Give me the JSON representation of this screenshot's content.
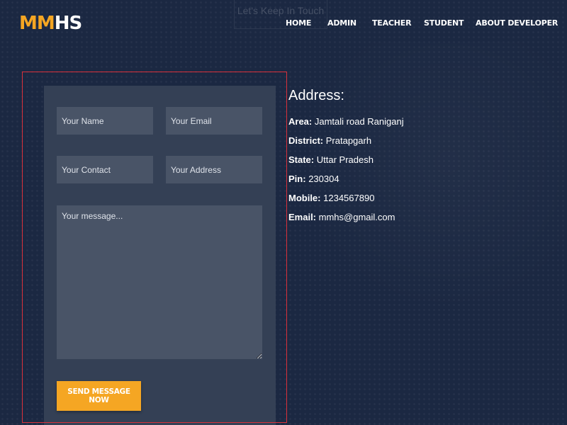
{
  "brand": {
    "logo_part1": "MM",
    "logo_part2": "HS"
  },
  "tagline": "Let's Keep In Touch",
  "nav": {
    "items": [
      {
        "label": "HOME"
      },
      {
        "label": "ADMIN"
      },
      {
        "label": "TEACHER"
      },
      {
        "label": "STUDENT"
      },
      {
        "label": "ABOUT DEVELOPER"
      }
    ]
  },
  "form": {
    "name_placeholder": "Your Name",
    "email_placeholder": "Your Email",
    "contact_placeholder": "Your Contact",
    "address_placeholder": "Your Address",
    "message_placeholder": "Your message...",
    "submit_label": "SEND MESSAGE NOW"
  },
  "address": {
    "heading": "Address:",
    "lines": [
      {
        "label": "Area:",
        "value": "Jamtali road Raniganj"
      },
      {
        "label": "District:",
        "value": "Pratapgarh"
      },
      {
        "label": "State:",
        "value": "Uttar Pradesh"
      },
      {
        "label": "Pin:",
        "value": "230304"
      },
      {
        "label": "Mobile:",
        "value": "1234567890"
      },
      {
        "label": "Email:",
        "value": "mmhs@gmail.com"
      }
    ]
  },
  "colors": {
    "background": "#1b2842",
    "accent": "#f5a623",
    "card": "#344055",
    "field": "#495467",
    "frame_border": "#d9303a"
  }
}
